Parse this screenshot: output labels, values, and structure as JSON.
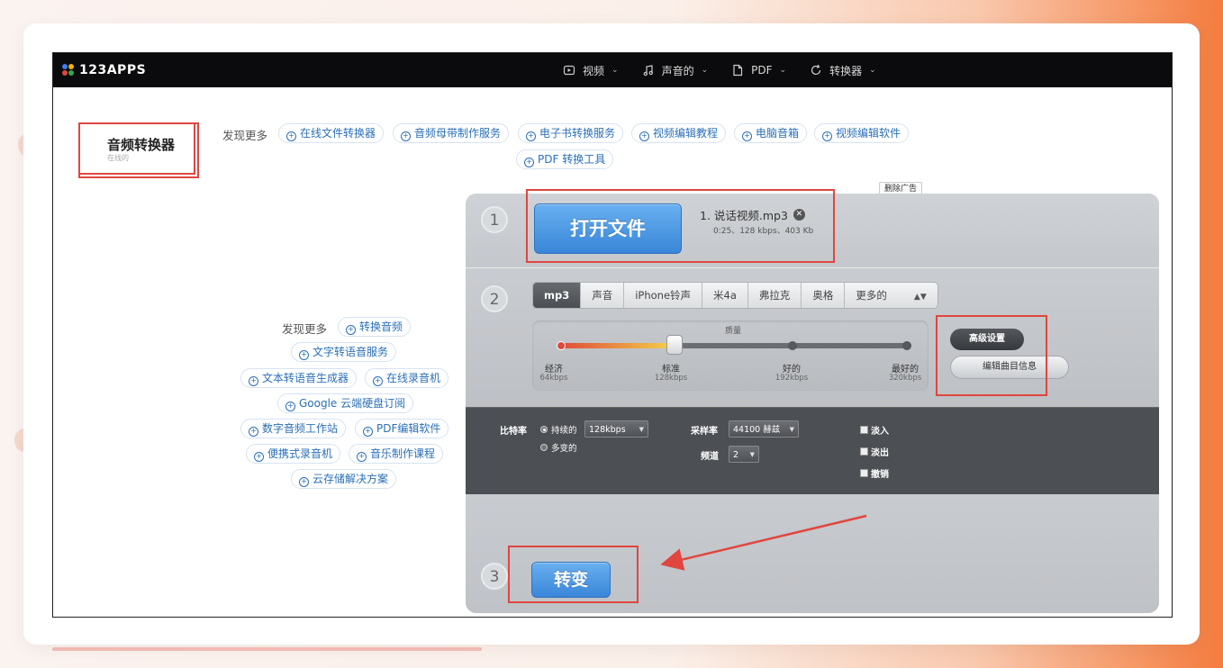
{
  "brand": {
    "name": "123APPS",
    "dot_colors": [
      "#3d7df0",
      "#f4b400",
      "#e0463f",
      "#34a853"
    ]
  },
  "nav": [
    {
      "label": "视频",
      "icon": "video-icon"
    },
    {
      "label": "声音的",
      "icon": "music-icon"
    },
    {
      "label": "PDF",
      "icon": "document-icon"
    },
    {
      "label": "转换器",
      "icon": "refresh-icon"
    }
  ],
  "page": {
    "title": "音频转换器",
    "subtitle": "在线的",
    "remove_ads": "删除广告"
  },
  "discover_top": {
    "label": "发现更多",
    "links": [
      "在线文件转换器",
      "音频母带制作服务",
      "电子书转换服务",
      "视频编辑教程",
      "电脑音箱",
      "视频编辑软件",
      "PDF 转换工具"
    ]
  },
  "discover_side": {
    "label": "发现更多",
    "links": [
      "转换音频",
      "文字转语音服务",
      "文本转语音生成器",
      "在线录音机",
      "Google 云端硬盘订阅",
      "数字音频工作站",
      "PDF编辑软件",
      "便携式录音机",
      "音乐制作课程",
      "云存储解决方案"
    ]
  },
  "step1": {
    "number": "1",
    "open_button": "打开文件",
    "file_name": "1. 说话视频.mp3",
    "file_meta": "0:25、128 kbps、403 Kb"
  },
  "step2": {
    "number": "2",
    "formats": [
      "mp3",
      "声音",
      "iPhone铃声",
      "米4a",
      "弗拉克",
      "奥格",
      "更多的"
    ],
    "active_format": "mp3",
    "quality": {
      "label": "质量",
      "levels": [
        {
          "name": "经济",
          "rate": "64kbps"
        },
        {
          "name": "标准",
          "rate": "128kbps"
        },
        {
          "name": "好的",
          "rate": "192kbps"
        },
        {
          "name": "最好的",
          "rate": "320kbps"
        }
      ],
      "selected_index": 1
    },
    "advanced_button": "高级设置",
    "edit_info_button": "编辑曲目信息"
  },
  "advanced": {
    "bitrate_label": "比特率",
    "bitrate_mode_constant": "持续的",
    "bitrate_mode_variable": "多变的",
    "bitrate_value": "128kbps",
    "sample_rate_label": "采样率",
    "sample_rate_value": "44100 赫兹",
    "channel_label": "频道",
    "channel_value": "2",
    "fade_in": "淡入",
    "fade_out": "淡出",
    "reverse": "撤销"
  },
  "step3": {
    "number": "3",
    "convert_button": "转变"
  },
  "annotation_color": "#e0463f"
}
